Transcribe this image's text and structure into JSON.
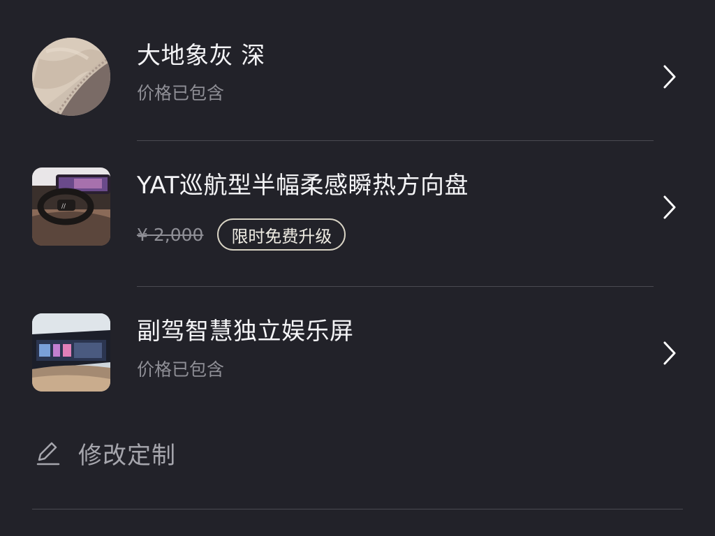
{
  "items": [
    {
      "title": "大地象灰 深",
      "subtitle": "价格已包含",
      "thumbnail": "interior-fabric-swatch"
    },
    {
      "title": "YAT巡航型半幅柔感瞬热方向盘",
      "price_old": "¥ 2,000",
      "badge": "限时免费升级",
      "thumbnail": "steering-wheel-photo"
    },
    {
      "title": "副驾智慧独立娱乐屏",
      "subtitle": "价格已包含",
      "thumbnail": "passenger-screen-photo"
    }
  ],
  "edit": {
    "label": "修改定制",
    "icon": "pencil-icon"
  },
  "colors": {
    "background": "#222229",
    "text": "#f4f4f6",
    "muted": "#8f8f96",
    "badge_border": "#d8d3c4"
  }
}
